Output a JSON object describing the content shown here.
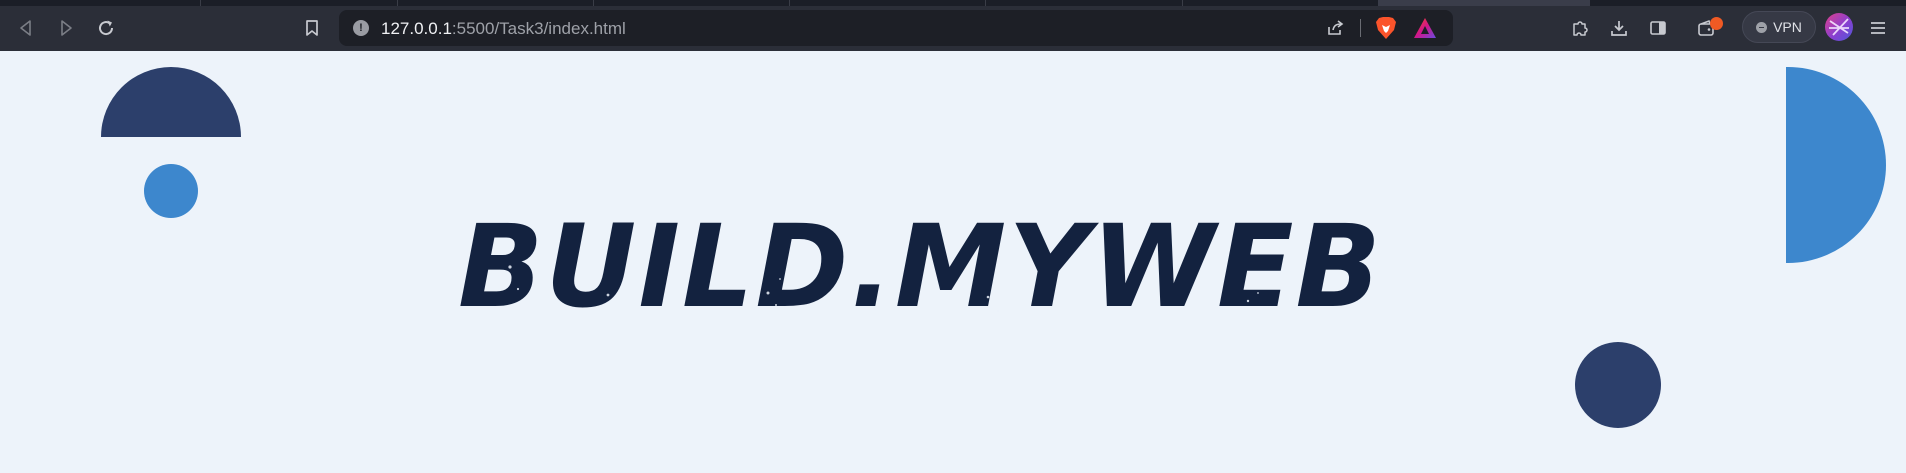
{
  "browser": {
    "url_host": "127.0.0.1",
    "url_path": ":5500/Task3/index.html",
    "vpn_label": "VPN",
    "icons": {
      "back": "back-icon",
      "forward": "forward-icon",
      "reload": "reload-icon",
      "bookmark": "bookmark-icon",
      "site_info": "info-icon",
      "share": "share-icon",
      "brave_shields": "brave-lion-icon",
      "brave_rewards": "rewards-triangle-icon",
      "extensions": "puzzle-icon",
      "downloads": "download-icon",
      "sidebar": "sidebar-icon",
      "wallet": "wallet-icon",
      "menu": "hamburger-icon"
    }
  },
  "page": {
    "logo_text": "BUILD.MYWEB",
    "colors": {
      "background": "#edf3fa",
      "dark_blue": "#2c3f6b",
      "accent_blue": "#3d87cd",
      "logo_navy": "#13223f"
    }
  }
}
